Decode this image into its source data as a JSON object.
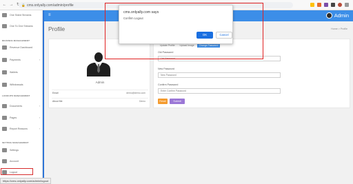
{
  "browser": {
    "url": "cms.onlyally.com/admin/profile"
  },
  "sidebar": {
    "items_top": [
      {
        "label": "One Sided Streams",
        "icon": "camera-icon"
      },
      {
        "label": "One To One Streams",
        "icon": "camera-icon"
      }
    ],
    "revenue_section": "REVENUE MANAGEMENT",
    "revenue_items": [
      {
        "label": "Revenue Dashboard",
        "icon": "chart-icon"
      },
      {
        "label": "Payments",
        "icon": "wallet-icon"
      },
      {
        "label": "Wallets",
        "icon": "wallet-icon"
      },
      {
        "label": "Withdrawals",
        "icon": "withdraw-icon"
      }
    ],
    "lookups_section": "LOOKUPS MANAGEMENT",
    "lookup_items": [
      {
        "label": "Documents",
        "icon": "document-icon"
      },
      {
        "label": "Pages",
        "icon": "page-icon"
      },
      {
        "label": "Report Reasons",
        "icon": "flag-icon"
      }
    ],
    "settings_section": "SETTING MANAGEMENT",
    "settings_items": [
      {
        "label": "Settings",
        "icon": "gear-icon"
      },
      {
        "label": "Account",
        "icon": "user-icon"
      },
      {
        "label": "Logout",
        "icon": "power-icon"
      }
    ]
  },
  "header": {
    "admin_name": "Admin"
  },
  "page": {
    "title": "Profile",
    "breadcrumb": "Home > Profile"
  },
  "profile": {
    "name": "Admin",
    "rows": [
      {
        "label": "Email",
        "value": "demo@demo.com"
      },
      {
        "label": "About Me",
        "value": "Demo"
      }
    ]
  },
  "password_form": {
    "tabs": [
      "Update Profile",
      "Upload Image",
      "Change Password"
    ],
    "old_label": "Old Password",
    "old_placeholder": "Old Password",
    "new_label": "New Password",
    "new_placeholder": "New Password",
    "confirm_label": "Confirm Password",
    "confirm_placeholder": "Enter Confirm Password",
    "reset_label": "Reset",
    "submit_label": "Submit"
  },
  "dialog": {
    "title": "cms.onlyally.com says",
    "message": "Confirm Logout",
    "ok_label": "OK",
    "cancel_label": "Cancel"
  },
  "status_bar": {
    "url": "https://cms.onlyally.com/admin/logout"
  },
  "colors": {
    "accent": "#3c8ee8",
    "reset": "#f49b2e",
    "submit": "#9b77d6",
    "highlight": "#e02020"
  }
}
